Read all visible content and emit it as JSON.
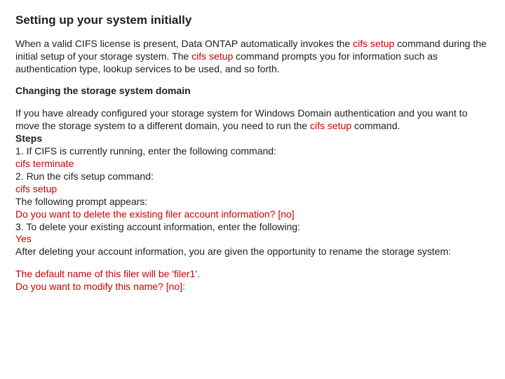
{
  "title": "Setting up your system initially",
  "intro": {
    "pre": "When a valid CIFS license is present, Data ONTAP automatically invokes the ",
    "cmd1": "cifs setup",
    "mid": " command during the initial setup of your storage system. The ",
    "cmd2": "cifs setup",
    "post": " command prompts you for information such as authentication type, lookup services to be used, and so forth."
  },
  "subheading": "Changing the storage system domain",
  "body": {
    "p1a": "If you have already configured your storage system for Windows Domain authentication and you want to move the storage system to a different domain, you need to run the ",
    "p1cmd": "cifs setup",
    "p1b": " command.",
    "steps_label": "Steps",
    "s1a": "1. If CIFS is currently running, enter the following command:",
    "s1cmd": "cifs terminate",
    "s2a": "2. Run the cifs setup command:",
    "s2cmd": "cifs setup",
    "s2prompt_lead": "The following prompt appears:",
    "s2prompt": "Do you want to delete the existing filer account information? [no]",
    "s3a": "3. To delete your existing account information, enter the following:",
    "s3ans": "Yes",
    "s3after": "After deleting your account information, you are given the opportunity to rename the storage system:"
  },
  "tail": {
    "l1": "The default name of this filer will be 'filer1'.",
    "l2": "Do you want to modify this name? [no]:"
  }
}
